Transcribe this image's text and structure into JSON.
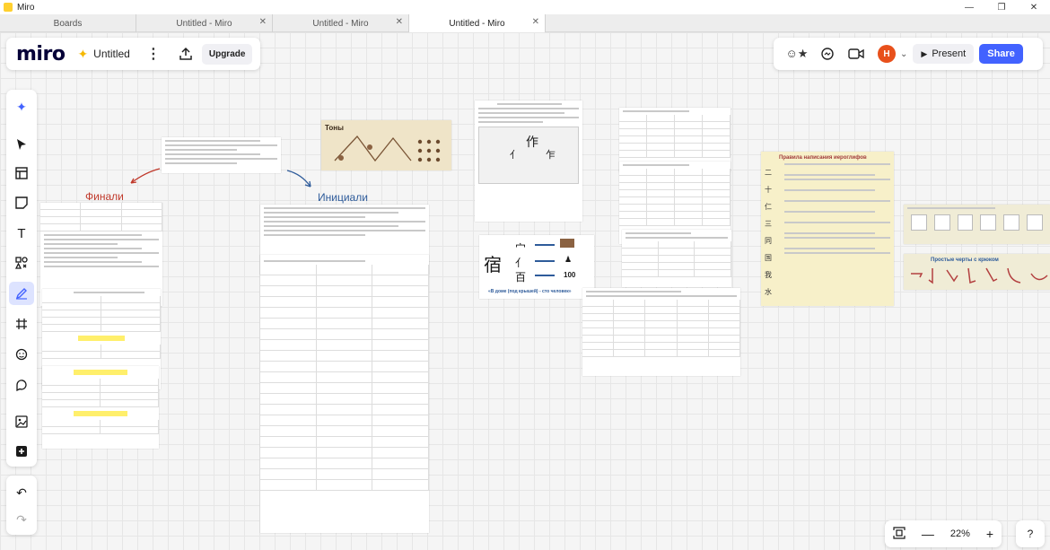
{
  "window": {
    "title": "Miro"
  },
  "tabs": [
    {
      "label": "Boards",
      "closable": false,
      "active": false
    },
    {
      "label": "Untitled - Miro",
      "closable": true,
      "active": false
    },
    {
      "label": "Untitled - Miro",
      "closable": true,
      "active": false
    },
    {
      "label": "Untitled - Miro",
      "closable": true,
      "active": true
    }
  ],
  "header": {
    "logo": "miro",
    "board_name": "Untitled",
    "upgrade_label": "Upgrade"
  },
  "topright": {
    "avatar_initial": "H",
    "present_label": "Present",
    "share_label": "Share"
  },
  "zoom": {
    "level": "22%"
  },
  "board": {
    "finals_title": "Финали",
    "initials_title": "Инициали",
    "house_caption": "«В доме (под крышей) - сто человек»",
    "house_number": "100",
    "rules_title": "Правила написания иероглифов",
    "strokes_title": "Простые черты с крюком",
    "tones_title": "Тоны"
  },
  "colors": {
    "accent": "#4262ff",
    "avatar": "#e8501b",
    "brand_yellow": "#ffd02f"
  }
}
